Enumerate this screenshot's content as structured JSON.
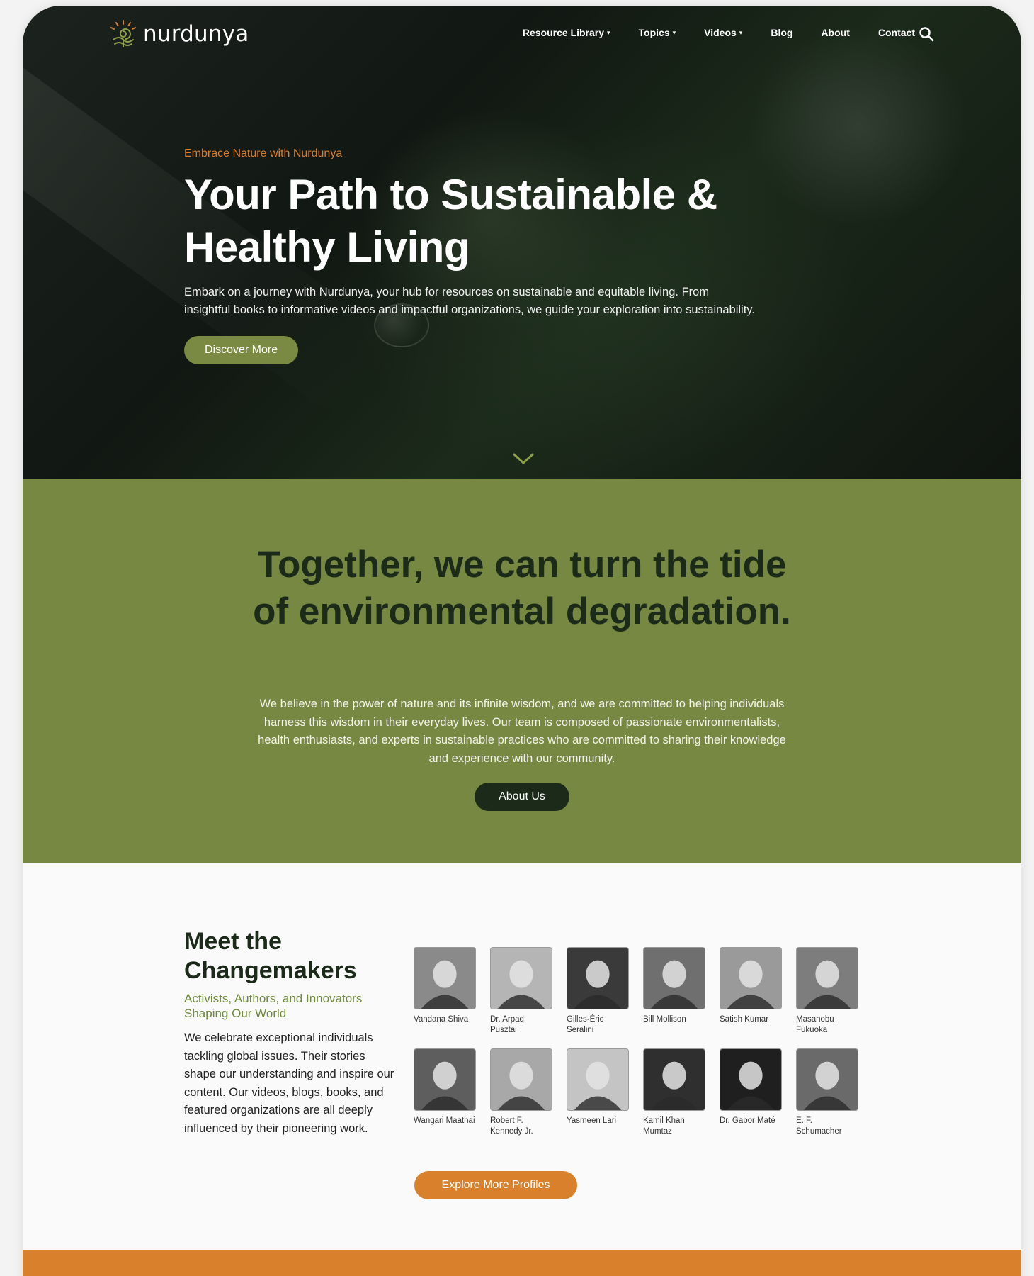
{
  "nav": {
    "logo_text": "nurdunya",
    "items": [
      {
        "label": "Resource Library",
        "dropdown": true
      },
      {
        "label": "Topics",
        "dropdown": true
      },
      {
        "label": "Videos",
        "dropdown": true
      },
      {
        "label": "Blog",
        "dropdown": false
      },
      {
        "label": "About",
        "dropdown": false
      },
      {
        "label": "Contact",
        "dropdown": false
      }
    ],
    "caret": "▾",
    "search_icon": "search-icon"
  },
  "hero": {
    "eyebrow": "Embrace Nature with Nurdunya",
    "title": "Your Path to Sustainable & Healthy Living",
    "description": "Embark on a journey with Nurdunya, your hub for resources on sustainable and equitable living. From insightful books to informative videos and impactful organizations, we guide your exploration into sustainability.",
    "cta": "Discover More",
    "scroll_icon": "chevron-down-icon"
  },
  "mission": {
    "title": "Together, we can turn the tide of environmental degradation.",
    "description": "We believe in the power of nature and its infinite wisdom, and we are committed to helping individuals harness this wisdom in their everyday lives. Our team is composed of passionate environmentalists, health enthusiasts, and experts in sustainable practices who are committed to sharing their knowledge and experience with our community.",
    "cta": "About Us"
  },
  "changemakers": {
    "title": "Meet the Changemakers",
    "subtitle": "Activists, Authors, and Innovators Shaping Our World",
    "description": "We celebrate exceptional individuals tackling global issues. Their stories shape our understanding and inspire our content. Our videos, blogs, books, and featured organizations are all deeply influenced by their pioneering work.",
    "profiles": [
      {
        "name": "Vandana Shiva"
      },
      {
        "name": "Dr. Arpad Pusztai"
      },
      {
        "name": "Gilles-Éric Seralini"
      },
      {
        "name": "Bill Mollison"
      },
      {
        "name": "Satish Kumar"
      },
      {
        "name": "Masanobu Fukuoka"
      },
      {
        "name": "Wangari Maathai"
      },
      {
        "name": "Robert F. Kennedy Jr."
      },
      {
        "name": "Yasmeen Lari"
      },
      {
        "name": "Kamil Khan Mumtaz"
      },
      {
        "name": "Dr. Gabor Maté"
      },
      {
        "name": "E. F. Schumacher"
      }
    ],
    "cta": "Explore More Profiles"
  },
  "colors": {
    "accent_orange": "#d8802b",
    "accent_green": "#778843",
    "button_green": "#7a8a42",
    "dark_green": "#1b2a19"
  }
}
